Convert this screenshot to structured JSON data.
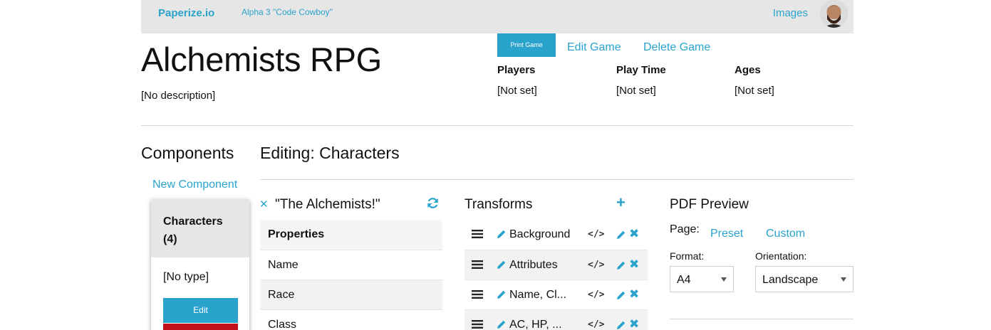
{
  "nav": {
    "brand": "Paperize.io",
    "version": "Alpha 3 \"Code Cowboy\"",
    "images_label": "Images"
  },
  "game": {
    "title": "Alchemists RPG",
    "description": "[No description]",
    "print_label": "Print Game",
    "edit_label": "Edit Game",
    "delete_label": "Delete Game",
    "meta": [
      {
        "label": "Players",
        "value": "[Not set]"
      },
      {
        "label": "Play Time",
        "value": "[Not set]"
      },
      {
        "label": "Ages",
        "value": "[Not set]"
      }
    ]
  },
  "components": {
    "title": "Components",
    "new_label": "New Component",
    "card": {
      "name": "Characters (4)",
      "type": "[No type]",
      "edit_label": "Edit"
    }
  },
  "editing": {
    "title": "Editing: Characters",
    "item_name": "\"The Alchemists!\"",
    "properties_header": "Properties",
    "properties": [
      "Name",
      "Race",
      "Class"
    ]
  },
  "transforms": {
    "title": "Transforms",
    "items": [
      {
        "name": "Background",
        "code": "</>"
      },
      {
        "name": "Attributes",
        "code": "</>"
      },
      {
        "name": "Name, Cl...",
        "code": "</>"
      },
      {
        "name": "AC, HP, ...",
        "code": "</>"
      }
    ]
  },
  "pdf": {
    "title": "PDF Preview",
    "page_label": "Page:",
    "preset_label": "Preset",
    "custom_label": "Custom",
    "format_label": "Format:",
    "format_value": "A4",
    "orientation_label": "Orientation:",
    "orientation_value": "Landscape"
  },
  "colors": {
    "accent": "#2aa3cc",
    "danger": "#c0101c",
    "nav_bg": "#e6e6e6"
  },
  "icons": {
    "refresh": "refresh-icon",
    "close": "close-icon",
    "add": "plus-icon",
    "drag": "drag-handle-icon",
    "edit": "pencil-icon",
    "code": "code-icon",
    "delete": "x-icon"
  }
}
